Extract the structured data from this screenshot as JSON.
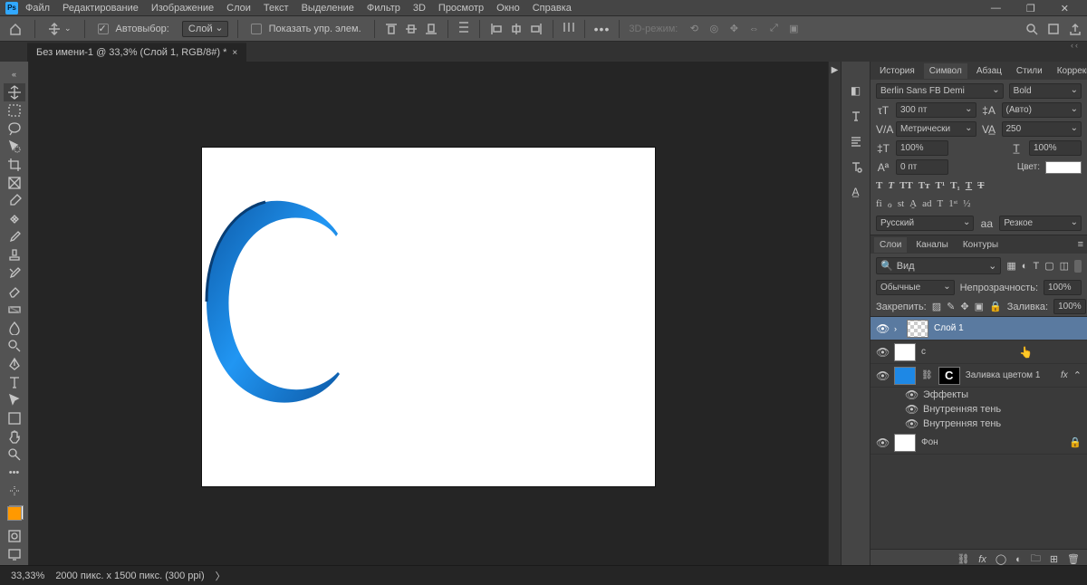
{
  "menu": {
    "items": [
      "Файл",
      "Редактирование",
      "Изображение",
      "Слои",
      "Текст",
      "Выделение",
      "Фильтр",
      "3D",
      "Просмотр",
      "Окно",
      "Справка"
    ]
  },
  "optbar": {
    "autoselect": "Автовыбор:",
    "autoselect_val": "Слой",
    "showcontrols": "Показать упр. элем.",
    "mode3d": "3D-режим:"
  },
  "tab": {
    "title": "Без имени-1 @ 33,3% (Слой 1, RGB/8#) *"
  },
  "status": {
    "zoom": "33,33%",
    "info": "2000 пикс. x 1500 пикс. (300 ppi)"
  },
  "panel_tabs1": [
    "История",
    "Символ",
    "Абзац",
    "Стили",
    "Коррекция"
  ],
  "char": {
    "font": "Berlin Sans FB Demi",
    "weight": "Bold",
    "size": "300 пт",
    "leading": "(Авто)",
    "kerning": "Метрически",
    "tracking": "250",
    "vscale": "100%",
    "hscale": "100%",
    "baseline": "0 пт",
    "color_label": "Цвет:",
    "lang": "Русский",
    "aa_icon": "aa",
    "aa": "Резкое"
  },
  "panel_tabs2": [
    "Слои",
    "Каналы",
    "Контуры"
  ],
  "layers": {
    "search": "Вид",
    "blend": "Обычные",
    "opacity_label": "Непрозрачность:",
    "opacity": "100%",
    "lock_label": "Закрепить:",
    "fill_label": "Заливка:",
    "fill": "100%",
    "items": [
      {
        "name": "Слой 1"
      },
      {
        "name": "c"
      },
      {
        "name": "Заливка цветом 1"
      },
      {
        "name": "Фон"
      }
    ],
    "fx": "Эффекты",
    "fx_items": [
      "Внутренняя тень",
      "Внутренняя тень"
    ]
  }
}
